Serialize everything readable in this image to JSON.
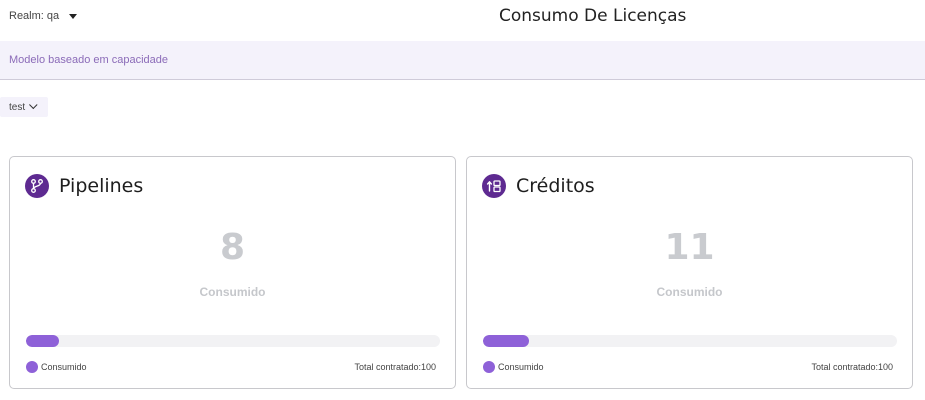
{
  "header": {
    "realm_label": "Realm: qa",
    "title": "Consumo De Licenças"
  },
  "model_strip": {
    "text": "Modelo baseado em capacidade"
  },
  "environment_select": {
    "value": "test"
  },
  "cards": [
    {
      "icon": "git-branch-icon",
      "title": "Pipelines",
      "value": "8",
      "value_label": "Consumido",
      "progress_fraction": 0.08,
      "legend_label": "Consumido",
      "total_label": "Total contratado:100"
    },
    {
      "icon": "credits-exchange-icon",
      "title": "Créditos",
      "value": "11",
      "value_label": "Consumido",
      "progress_fraction": 0.11,
      "legend_label": "Consumido",
      "total_label": "Total contratado:100"
    }
  ],
  "colors": {
    "accent": "#8e61d8",
    "icon_bg": "#5e2a91",
    "strip_bg": "#f4f2fb",
    "strip_text": "#8b6bb8"
  }
}
